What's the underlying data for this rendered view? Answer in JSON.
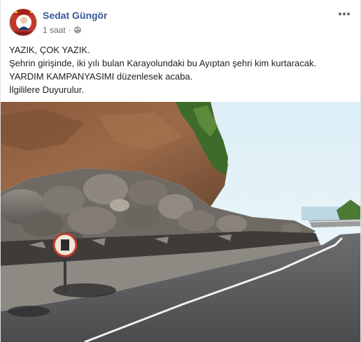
{
  "post": {
    "author": "Sedat Güngör",
    "time": "1 saat",
    "privacy_icon": "globe-icon",
    "more_icon": "ellipsis-icon",
    "text_lines": [
      "YAZIK, ÇOK YAZIK.",
      "Şehrin girişinde, iki yılı bulan Karayolundaki bu Ayıptan şehri kim kurtaracak.",
      "YARDIM KAMPANYASIMI düzenlesek acaba.",
      "İlgililere Duyurulur."
    ],
    "photo_subject": "rockfall-road-photo"
  },
  "colors": {
    "author_link": "#385898",
    "meta_text": "#616770",
    "body_text": "#1c1e21"
  }
}
